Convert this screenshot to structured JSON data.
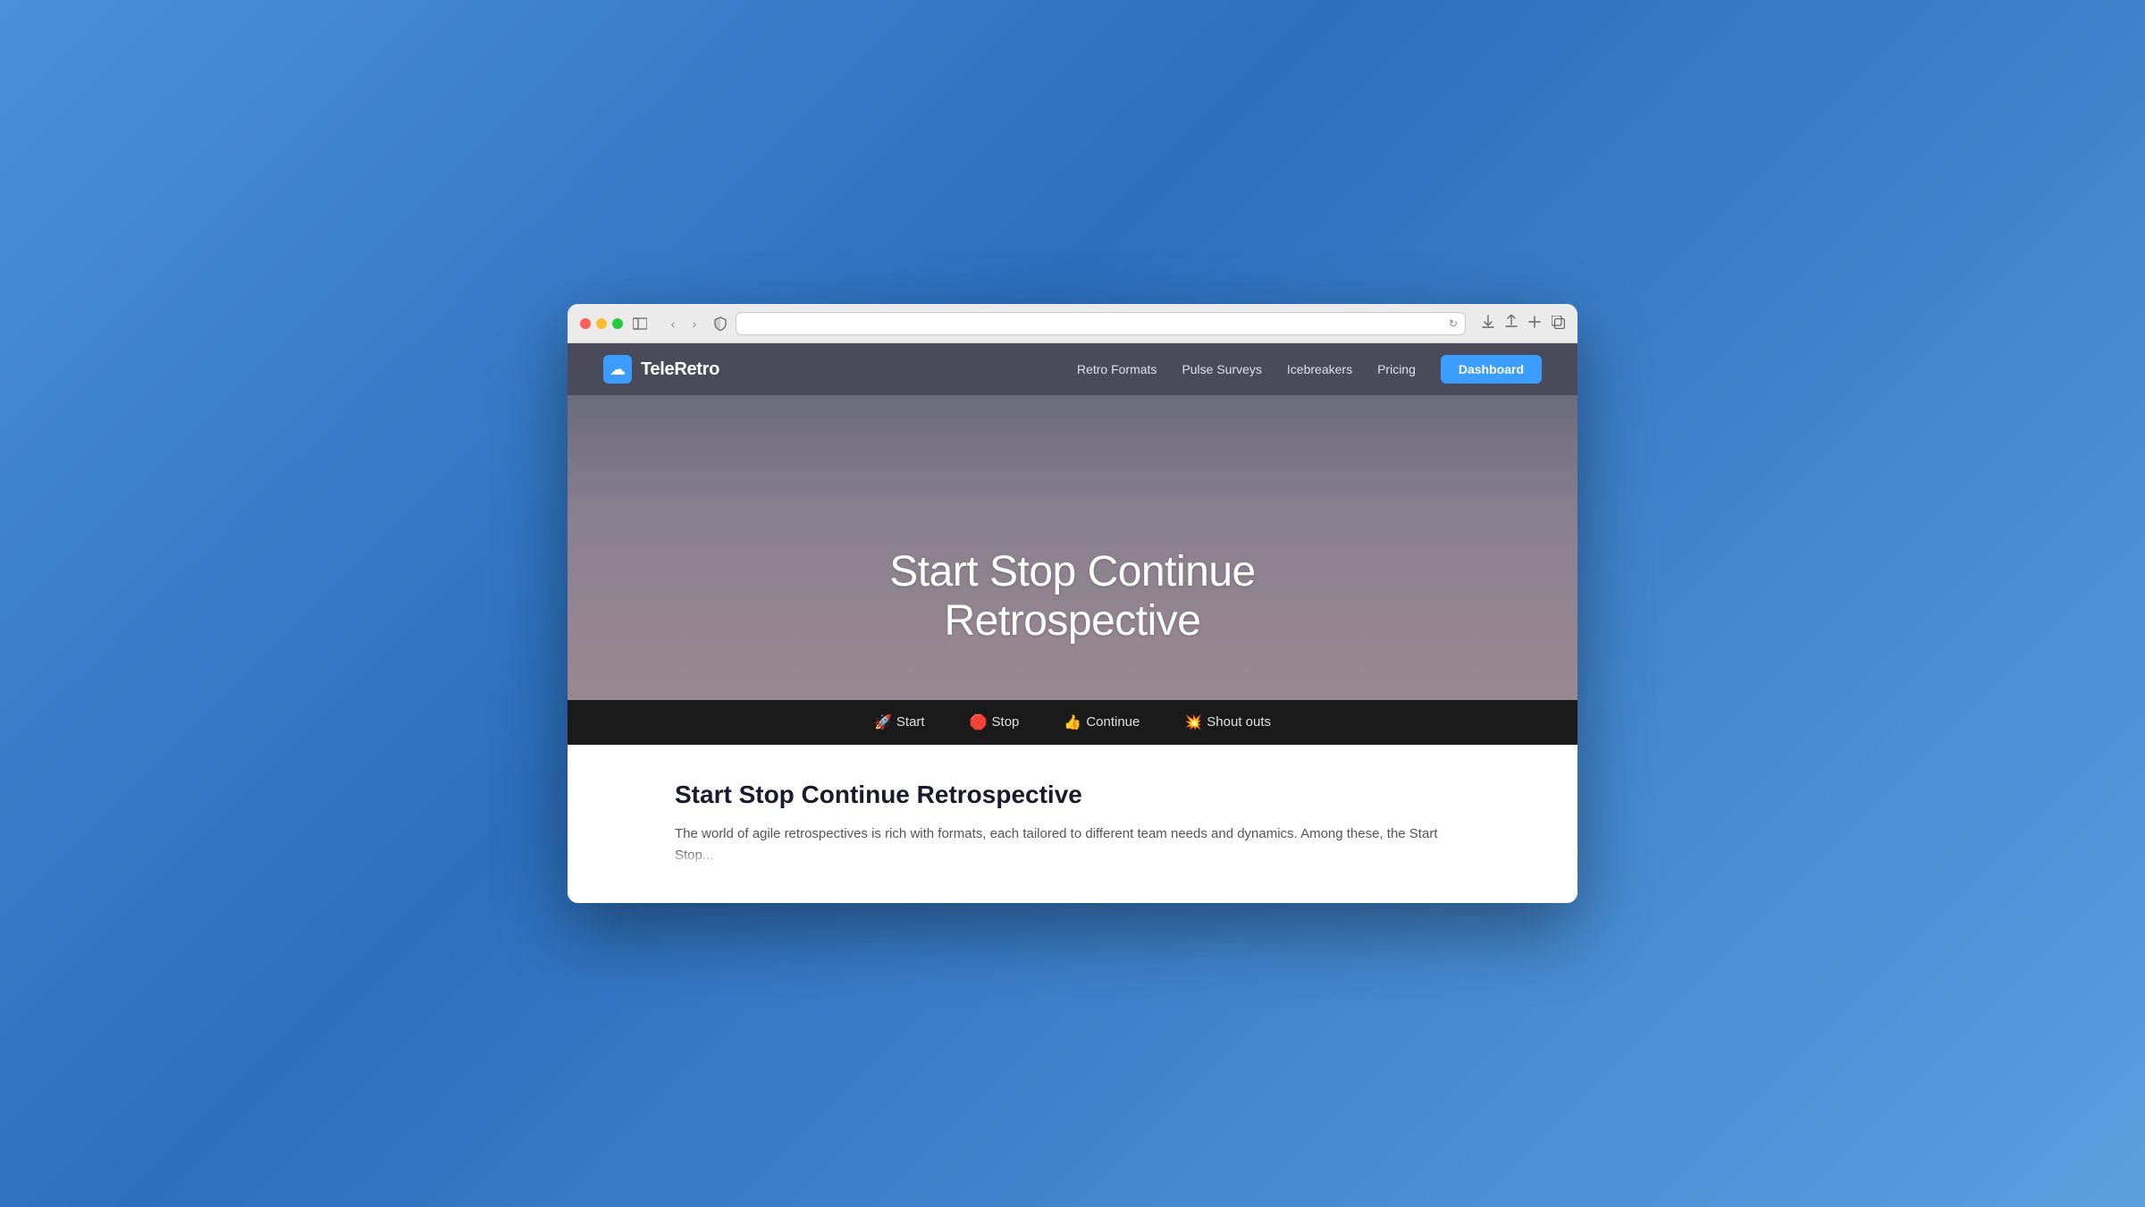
{
  "browser": {
    "address_bar_placeholder": ""
  },
  "nav": {
    "logo_text": "TeleRetro",
    "links": [
      {
        "label": "Retro Formats",
        "id": "retro-formats"
      },
      {
        "label": "Pulse Surveys",
        "id": "pulse-surveys"
      },
      {
        "label": "Icebreakers",
        "id": "icebreakers"
      },
      {
        "label": "Pricing",
        "id": "pricing"
      }
    ],
    "dashboard_label": "Dashboard"
  },
  "hero": {
    "title_line1": "Start Stop Continue",
    "title_line2": "Retrospective"
  },
  "tabs": [
    {
      "emoji": "🚀",
      "label": "Start"
    },
    {
      "emoji": "🛑",
      "label": "Stop"
    },
    {
      "emoji": "👍",
      "label": "Continue"
    },
    {
      "emoji": "💥",
      "label": "Shout outs"
    }
  ],
  "content": {
    "title": "Start Stop Continue Retrospective",
    "text": "The world of agile retrospectives is rich with formats, each tailored to different team needs and dynamics. Among these, the Start Stop..."
  }
}
